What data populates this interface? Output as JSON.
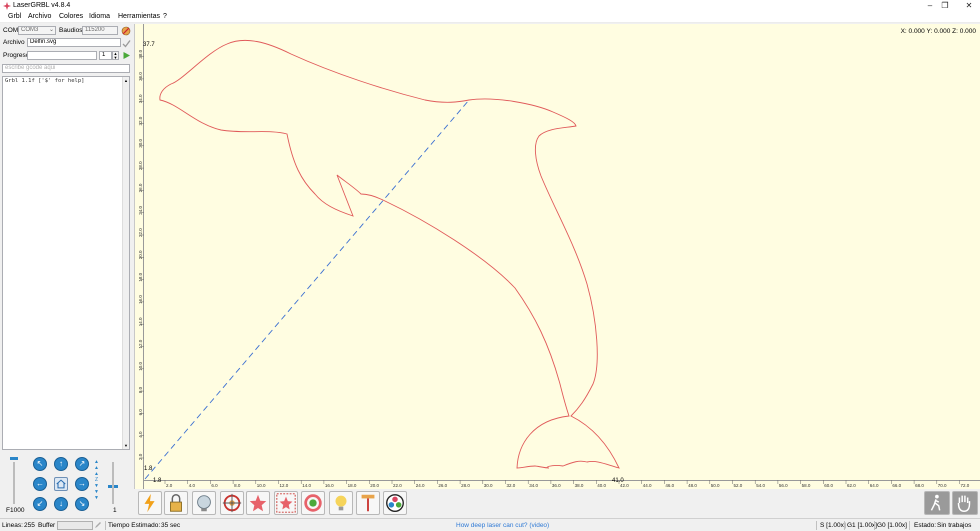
{
  "window": {
    "title": "LaserGRBL v4.8.4",
    "minimize": "–",
    "restore": "❐",
    "close": "✕"
  },
  "menu": [
    "Grbl",
    "Archivo",
    "Colores",
    "Idioma",
    "Herramientas",
    "?"
  ],
  "left": {
    "com_label": "COM",
    "com_value": "COM3",
    "baud_label": "Baudios",
    "baud_value": "115200",
    "file_label": "Archivo",
    "file_value": "Delfin.svg",
    "progress_label": "Progreso",
    "copies_value": "1",
    "command_placeholder": "escribe gcode aqui",
    "console_line": "Grbl 1.1f ['$' for help]",
    "feed_label": "F1000",
    "step_value": "1"
  },
  "canvas": {
    "coords": "X: 0.000 Y: 0.000 Z: 0.000",
    "y_max_label": "37.7",
    "x_max_label": "41.0",
    "origin_label": "1.8",
    "origin_y_label": "1.8",
    "x_ticks": [
      "2.0",
      "4.0",
      "6.0",
      "8.0",
      "10.0",
      "12.0",
      "14.0",
      "16.0",
      "18.0",
      "20.0",
      "22.0",
      "24.0",
      "26.0",
      "28.0",
      "30.0",
      "32.0",
      "34.0",
      "36.0",
      "38.0",
      "40.0",
      "42.0",
      "44.0",
      "46.0",
      "48.0",
      "50.0",
      "52.0",
      "54.0",
      "56.0",
      "58.0",
      "60.0",
      "62.0",
      "64.0",
      "66.0",
      "68.0",
      "70.0",
      "72.0",
      "74.0"
    ],
    "y_ticks": [
      "2.0",
      "4.0",
      "6.0",
      "8.0",
      "10.0",
      "12.0",
      "14.0",
      "16.0",
      "18.0",
      "20.0",
      "22.0",
      "24.0",
      "26.0",
      "28.0",
      "30.0",
      "32.0",
      "34.0",
      "36.0",
      "38.0"
    ],
    "path_color": "#e05a5a",
    "travel_color": "#3b6fd1",
    "background": "#fffde1"
  },
  "toolbar_icons": [
    "laser-power-icon",
    "lock-icon",
    "globe-icon",
    "target-icon",
    "star-icon",
    "frame-star-icon",
    "ring-icon",
    "bulb-icon",
    "pin-icon",
    "color-wheel-icon"
  ],
  "status": {
    "lines_label": "Lineas:",
    "lines_value": "255",
    "buffer_label": "Buffer",
    "time_label": "Tiempo Estimado:",
    "time_value": "35 sec",
    "link": "How deep laser can cut? (video)",
    "s_override": "S [1.00x]",
    "g1_override": "G1 [1.00x]",
    "g0_override": "G0 [1.00x]",
    "state_label": "Estado:",
    "state_value": "Sin trabajos"
  }
}
